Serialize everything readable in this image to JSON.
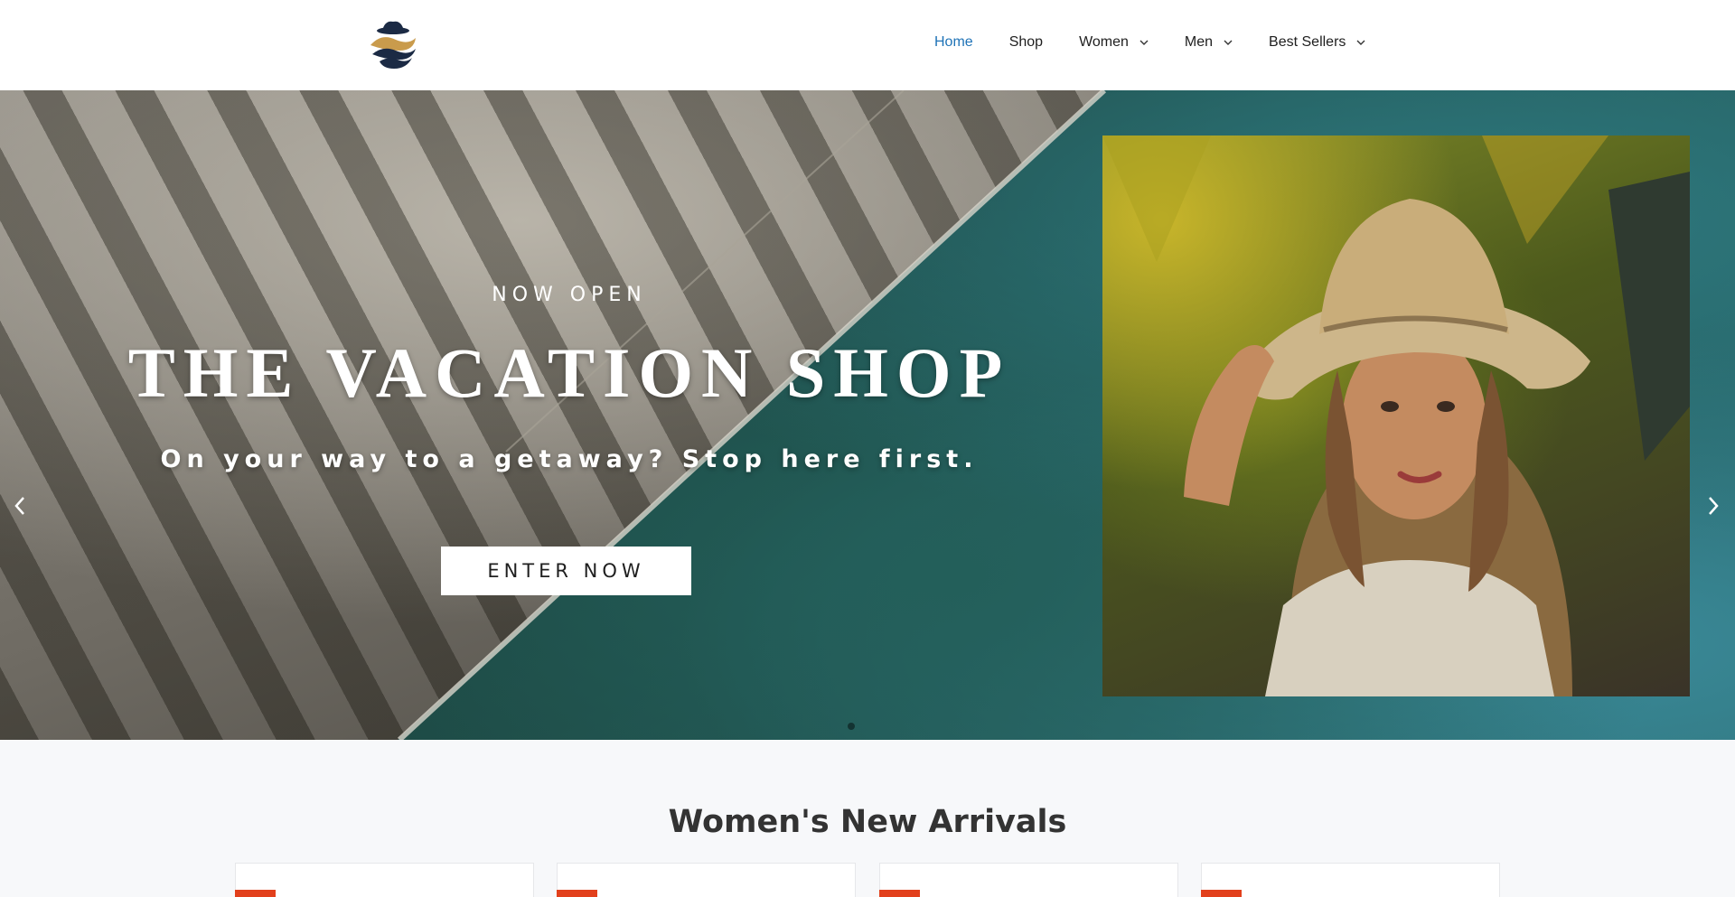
{
  "header": {
    "logo_alt": "The Vacation Shop logo",
    "nav": [
      {
        "label": "Home",
        "active": true,
        "has_dropdown": false
      },
      {
        "label": "Shop",
        "active": false,
        "has_dropdown": false
      },
      {
        "label": "Women",
        "active": false,
        "has_dropdown": true
      },
      {
        "label": "Men",
        "active": false,
        "has_dropdown": true
      },
      {
        "label": "Best Sellers",
        "active": false,
        "has_dropdown": true
      }
    ]
  },
  "hero": {
    "eyebrow": "NOW OPEN",
    "headline": "THE VACATION SHOP",
    "subline": "On your way to a getaway? Stop here first.",
    "cta_label": "ENTER NOW",
    "prev_icon": "chevron-left-icon",
    "next_icon": "chevron-right-icon"
  },
  "section": {
    "title": "Women's New Arrivals",
    "cards": [
      {
        "badge": "sale-badge"
      },
      {
        "badge": "sale-badge"
      },
      {
        "badge": "sale-badge"
      },
      {
        "badge": "sale-badge"
      }
    ]
  },
  "colors": {
    "nav_active": "#1f73b7",
    "badge": "#e2401c",
    "header_bg": "#ffffff",
    "page_bg": "#f7f8fa"
  }
}
